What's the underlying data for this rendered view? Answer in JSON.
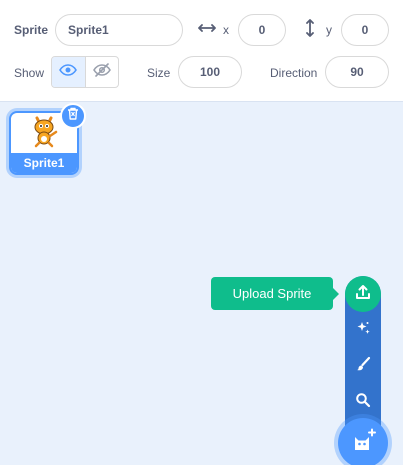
{
  "info": {
    "sprite_label": "Sprite",
    "sprite_name": "Sprite1",
    "x_label": "x",
    "x_value": "0",
    "y_label": "y",
    "y_value": "0",
    "show_label": "Show",
    "size_label": "Size",
    "size_value": "100",
    "direction_label": "Direction",
    "direction_value": "90"
  },
  "sprites": [
    {
      "name": "Sprite1",
      "selected": true
    }
  ],
  "add_menu": {
    "tooltip": "Upload Sprite",
    "items": [
      "upload-icon",
      "surprise-icon",
      "paint-icon",
      "search-icon"
    ],
    "main_icon": "cat-icon"
  },
  "colors": {
    "accent": "#4c97ff",
    "menu": "#3373cc",
    "highlight": "#0fbd8c",
    "background": "#e9f1fc"
  }
}
